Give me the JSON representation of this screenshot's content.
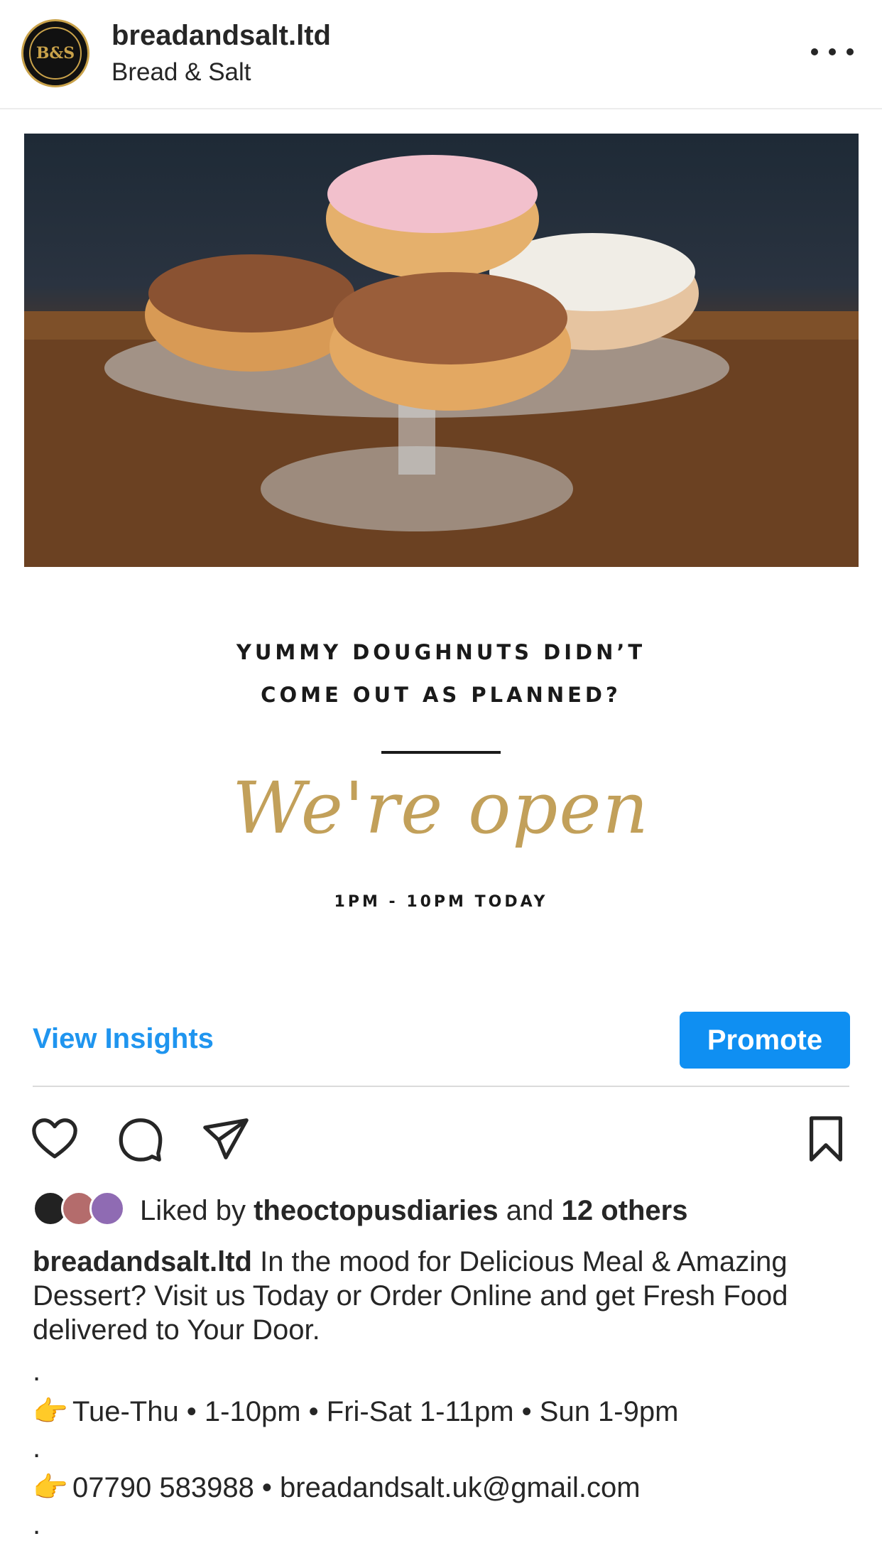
{
  "header": {
    "avatar_icon": "bread-and-salt-logo",
    "avatar_monogram": "B&S",
    "username": "breadandsalt.ltd",
    "subtitle": "Bread & Salt",
    "more_icon": "more-horizontal-icon"
  },
  "post": {
    "promo": {
      "line1": "YUMMY DOUGHNUTS DIDN’T",
      "line2": "COME OUT AS PLANNED?",
      "script": "We're open",
      "hours": "1PM - 10PM TODAY"
    }
  },
  "insights": {
    "view_label": "View Insights",
    "promote_label": "Promote",
    "accent_color": "#0f8ff2"
  },
  "actions": {
    "like_icon": "heart-icon",
    "comment_icon": "comment-icon",
    "share_icon": "paper-plane-icon",
    "save_icon": "bookmark-icon"
  },
  "likes": {
    "prefix": "Liked by",
    "user": "theoctopusdiaries",
    "conjunction": "and",
    "others": "12 others"
  },
  "caption": {
    "username": "breadandsalt.ltd",
    "text": "In the mood for Delicious Meal & Amazing Dessert? Visit us Today or Order Online and get Fresh Food delivered to Your Door.",
    "dot": ".",
    "hours_line": "Tue-Thu • 1-10pm • Fri-Sat 1-11pm • Sun 1-9pm",
    "contact_line": "07790 583988 • breadandsalt.uk@gmail.com",
    "pointer_emoji": "👉"
  }
}
